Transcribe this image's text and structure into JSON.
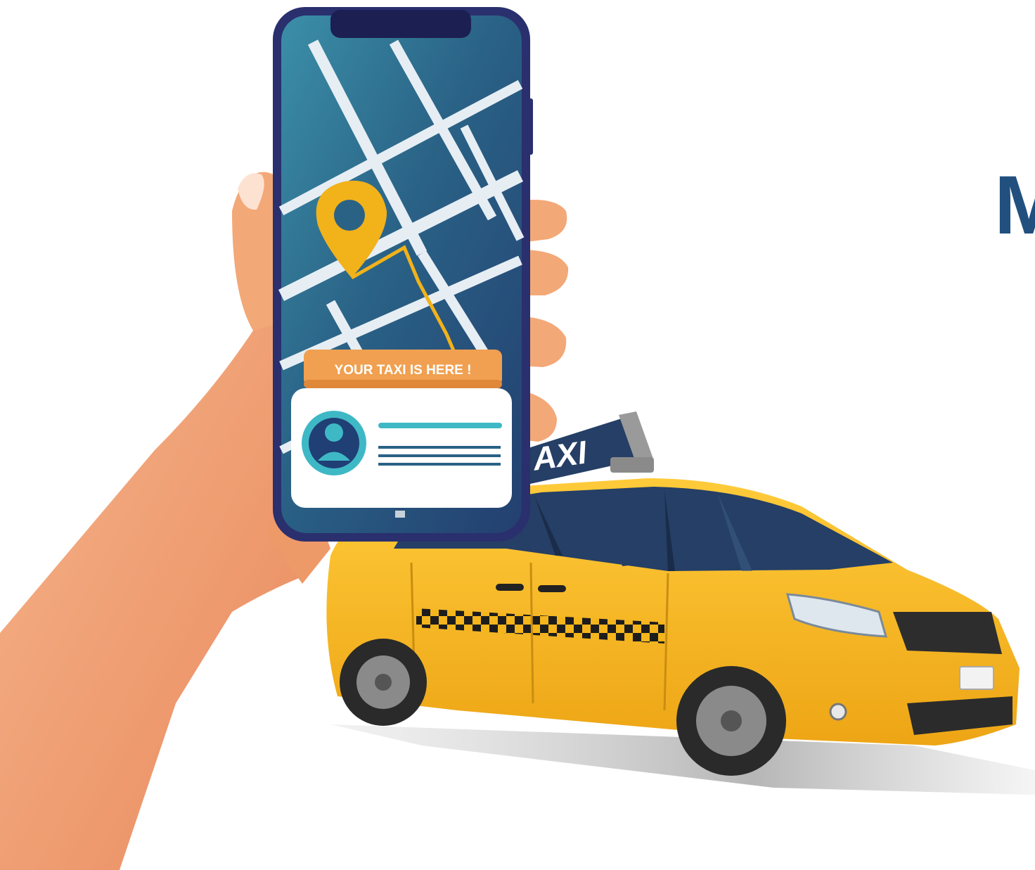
{
  "phone_screen": {
    "notification_label": "YOUR TAXI IS HERE !"
  },
  "taxi_roof_sign": {
    "label": "AXI"
  },
  "headline": {
    "visible_text": "M"
  },
  "colors": {
    "phone_frame": "#2a2f6e",
    "map_background": "#2f6a8f",
    "map_roads": "#e6eef4",
    "route_and_pin": "#f2b21a",
    "notification_badge": "#f0a050",
    "taxi_body": "#f5b51c",
    "taxi_windows": "#253f66",
    "skin": "#f3a878",
    "headline": "#21507f"
  }
}
